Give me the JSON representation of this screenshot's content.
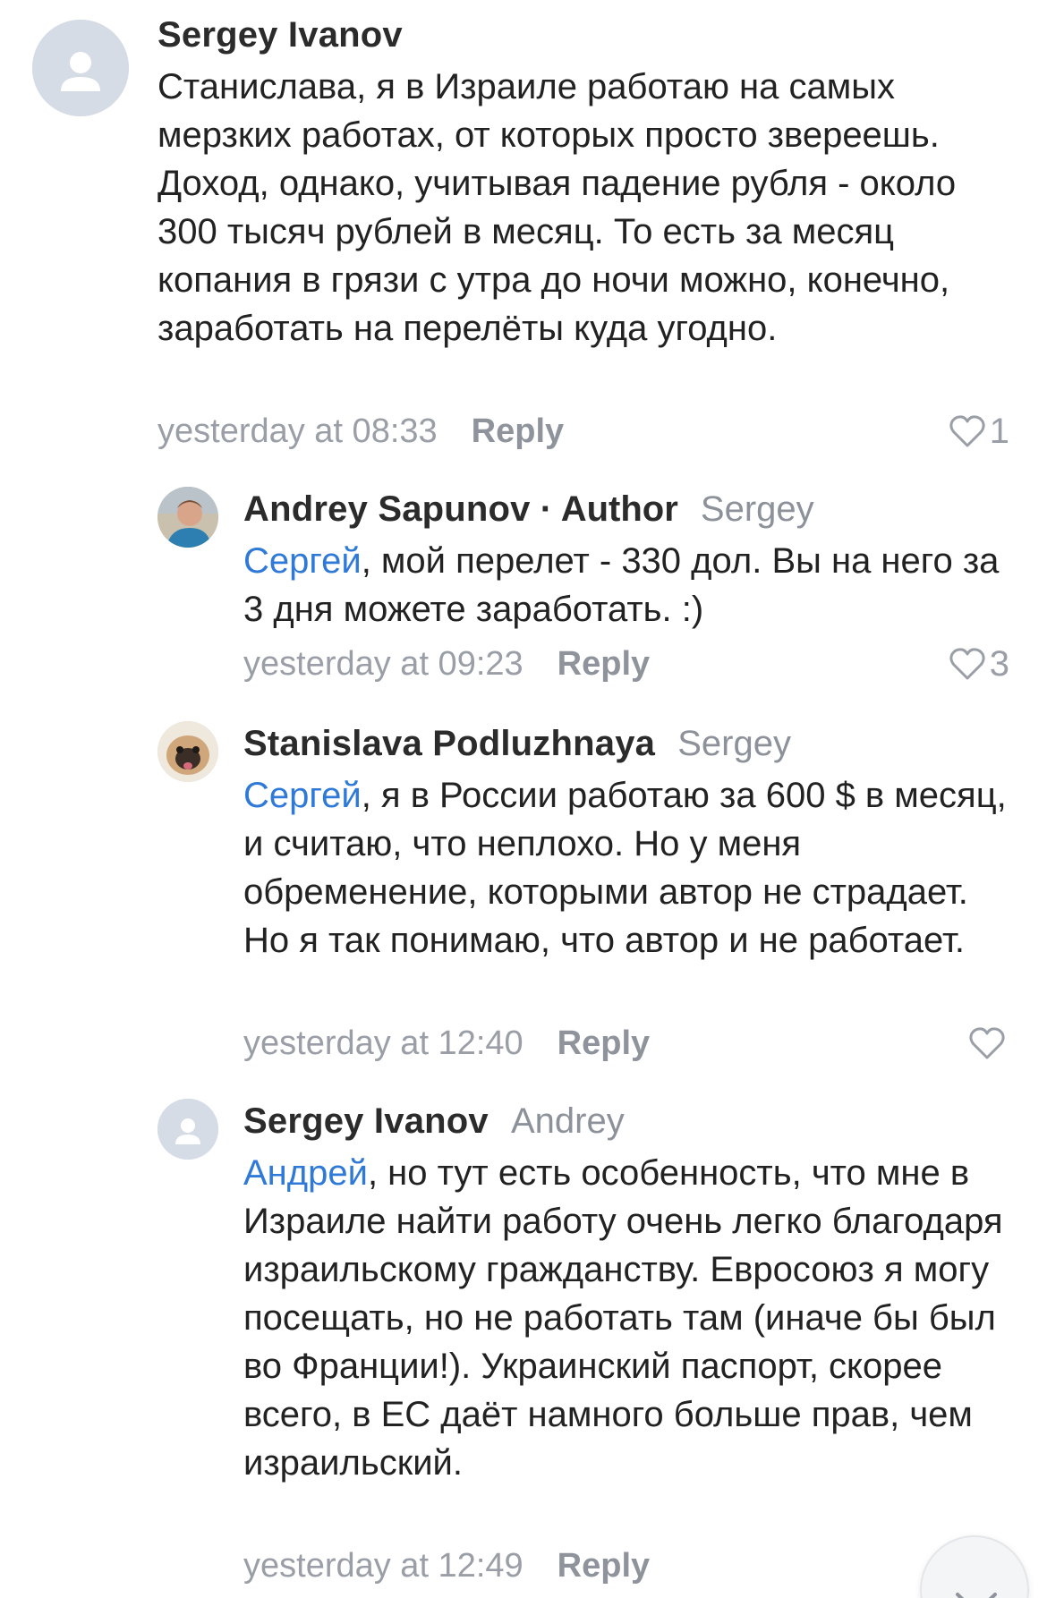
{
  "comments": [
    {
      "name": "Sergey Ivanov",
      "author_tag": "",
      "reply_to": "",
      "mention": "",
      "text": "Станислава, я в Израиле работаю на самых мерзких работах, от которых просто звереешь. Доход, однако, учитывая падение рубля - около 300 тысяч рублей в месяц. То есть за месяц копания в грязи с утра до ночи можно, конечно, заработать на перелёты куда угодно.",
      "time": "yesterday at 08:33",
      "reply_label": "Reply",
      "likes": "1",
      "avatar": "person-placeholder-icon"
    },
    {
      "name": "Andrey Sapunov",
      "author_tag": "· Author",
      "reply_to": "Sergey",
      "mention": "Сергей",
      "text": ", мой перелет - 330 дол. Вы на него за 3 дня можете заработать. :)",
      "time": "yesterday at 09:23",
      "reply_label": "Reply",
      "likes": "3",
      "avatar": "user-photo"
    },
    {
      "name": "Stanislava Podluzhnaya",
      "author_tag": "",
      "reply_to": "Sergey",
      "mention": "Сергей",
      "text": ", я в России работаю за 600 $ в месяц, и считаю, что неплохо. Но у меня обременение, которыми автор не страдает. Но я так понимаю, что автор и не работает.",
      "time": "yesterday at 12:40",
      "reply_label": "Reply",
      "likes": "",
      "avatar": "pug-photo"
    },
    {
      "name": "Sergey Ivanov",
      "author_tag": "",
      "reply_to": "Andrey",
      "mention": "Андрей",
      "text": ", но тут есть особенность, что мне в Израиле найти работу очень легко благодаря израильскому гражданству. Евросоюз я могу посещать, но не работать там (иначе бы был во Франции!). Украинский паспорт, скорее всего, в ЕС даёт намного больше прав, чем израильский.",
      "time": "yesterday at 12:49",
      "reply_label": "Reply",
      "likes": "",
      "avatar": "person-placeholder-icon"
    }
  ],
  "colors": {
    "mention": "#2f7ad8",
    "meta": "#9a9ea6",
    "name": "#2b2b2b"
  },
  "scroll_button_icon": "chevron-down-icon"
}
